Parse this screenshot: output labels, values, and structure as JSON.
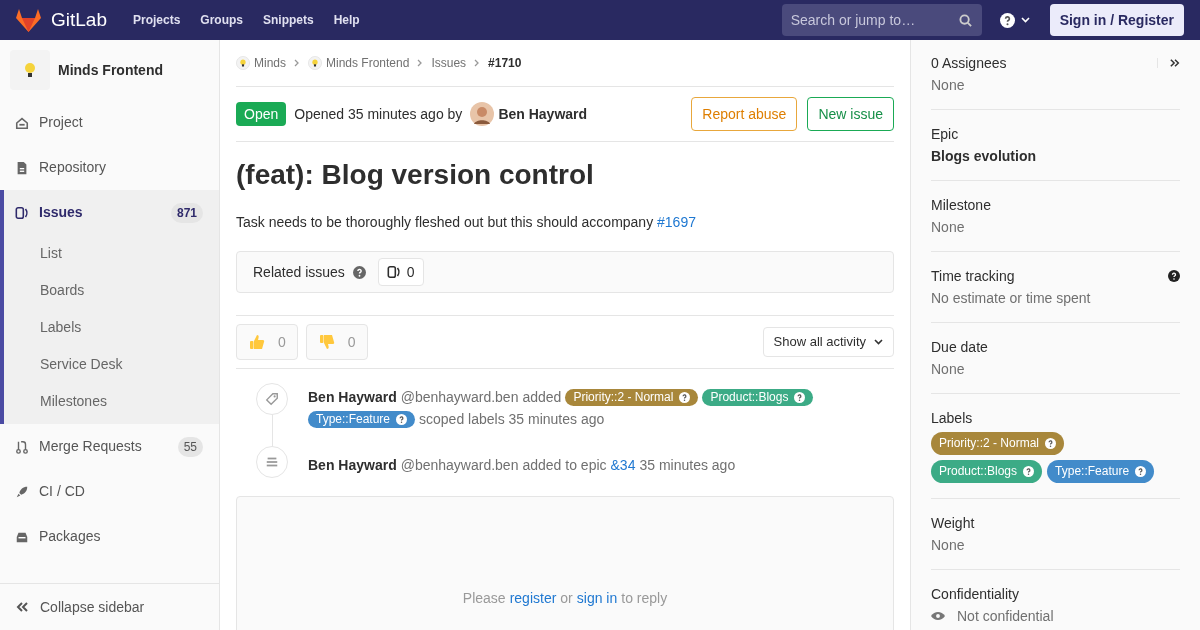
{
  "topbar": {
    "brand": "GitLab",
    "nav": [
      "Projects",
      "Groups",
      "Snippets",
      "Help"
    ],
    "search": {
      "placeholder": "Search or jump to…"
    },
    "sign_in": "Sign in / Register"
  },
  "sidebar": {
    "project": "Minds Frontend",
    "items": [
      {
        "label": "Project",
        "selected": false
      },
      {
        "label": "Repository",
        "selected": false
      },
      {
        "label": "Issues",
        "count": "871",
        "selected": true,
        "children": [
          {
            "label": "List"
          },
          {
            "label": "Boards"
          },
          {
            "label": "Labels"
          },
          {
            "label": "Service Desk"
          },
          {
            "label": "Milestones"
          }
        ]
      },
      {
        "label": "Merge Requests",
        "count": "55",
        "selected": false
      },
      {
        "label": "CI / CD",
        "selected": false
      },
      {
        "label": "Packages",
        "selected": false
      }
    ],
    "collapse": "Collapse sidebar"
  },
  "breadcrumbs": [
    {
      "label": "Minds",
      "avatar": true
    },
    {
      "label": "Minds Frontend",
      "avatar": true
    },
    {
      "label": "Issues",
      "avatar": false
    },
    {
      "label": "#1710",
      "avatar": false
    }
  ],
  "issue": {
    "status": "Open",
    "opened": "Opened 35 minutes ago by",
    "author": "Ben Hayward",
    "buttons": [
      {
        "label": "Report abuse",
        "kind": "warning"
      },
      {
        "label": "New issue",
        "kind": "success"
      }
    ],
    "title": "(feat): Blog version control",
    "description": "Task needs to be thoroughly fleshed out but this should accompany",
    "description_link": "#1697",
    "related": {
      "label": "Related issues",
      "count": "0"
    },
    "awards": [
      {
        "kind": "up",
        "count": "0"
      },
      {
        "kind": "down",
        "count": "0"
      }
    ],
    "activity_filter": "Show all activity",
    "events": [
      {
        "kind": "label",
        "author": "Ben Hayward",
        "handle": "@benhayward.ben",
        "parts": [
          {
            "kind": "text",
            "text": "added"
          },
          {
            "kind": "label",
            "text": "Priority::2 - Normal",
            "color": "#a8873b"
          },
          {
            "kind": "label",
            "text": "Product::Blogs",
            "color": "#3cab86"
          },
          {
            "kind": "label",
            "text": "Type::Feature",
            "color": "#428bca"
          },
          {
            "kind": "text",
            "text": "scoped labels 35 minutes ago"
          }
        ]
      },
      {
        "kind": "epic",
        "author": "Ben Hayward",
        "handle": "@benhayward.ben",
        "parts": [
          {
            "kind": "text",
            "text": "added to epic"
          },
          {
            "kind": "link",
            "text": "&34"
          },
          {
            "kind": "text",
            "text": "35 minutes ago"
          }
        ]
      }
    ],
    "reply": [
      {
        "kind": "text",
        "text": "Please"
      },
      {
        "kind": "link",
        "text": "register"
      },
      {
        "kind": "text",
        "text": "or"
      },
      {
        "kind": "link",
        "text": "sign in"
      },
      {
        "kind": "text",
        "text": "to reply"
      }
    ]
  },
  "right_sidebar": {
    "sections": [
      {
        "title": "0 Assignees",
        "value": "None",
        "kind": "assignees"
      },
      {
        "title": "Epic",
        "value": "Blogs evolution",
        "kind": "epic"
      },
      {
        "title": "Milestone",
        "value": "None",
        "kind": "plain"
      },
      {
        "title": "Time tracking",
        "value": "No estimate or time spent",
        "kind": "help"
      },
      {
        "title": "Due date",
        "value": "None",
        "kind": "plain"
      },
      {
        "title": "Labels",
        "kind": "labels",
        "labels": [
          {
            "text": "Priority::2 - Normal",
            "color": "#a8873b"
          },
          {
            "text": "Product::Blogs",
            "color": "#3cab86"
          },
          {
            "text": "Type::Feature",
            "color": "#428bca"
          }
        ]
      },
      {
        "title": "Weight",
        "value": "None",
        "kind": "plain"
      },
      {
        "title": "Confidentiality",
        "value": "Not confidential",
        "kind": "confidential"
      }
    ]
  }
}
